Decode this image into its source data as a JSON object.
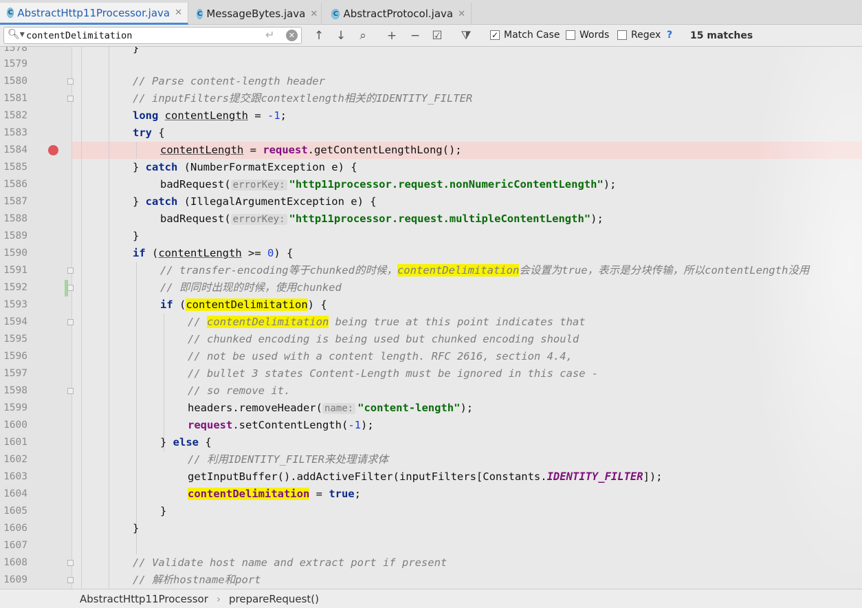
{
  "tabs": [
    {
      "label": "AbstractHttp11Processor.java",
      "active": true
    },
    {
      "label": "MessageBytes.java",
      "active": false
    },
    {
      "label": "AbstractProtocol.java",
      "active": false
    }
  ],
  "find": {
    "query": "contentDelimitation",
    "options": {
      "match_case": "Match Case",
      "words": "Words",
      "regex": "Regex",
      "help": "?"
    },
    "match_case_checked": true,
    "matches": "15 matches"
  },
  "gutter": {
    "lines": [
      "1578",
      "1579",
      "1580",
      "1581",
      "1582",
      "1583",
      "1584",
      "1585",
      "1586",
      "1587",
      "1588",
      "1589",
      "1590",
      "1591",
      "1592",
      "1593",
      "1594",
      "1595",
      "1596",
      "1597",
      "1598",
      "1599",
      "1600",
      "1601",
      "1602",
      "1603",
      "1604",
      "1605",
      "1606",
      "1607",
      "1608",
      "1609"
    ],
    "breakpoint_line": "1584"
  },
  "code": {
    "l1578": "}",
    "l1580": "// Parse content-length header",
    "l1581": "// inputFilters提交跟contextlength相关的IDENTITY_FILTER",
    "l1582a": "long",
    "l1582b": "contentLength",
    "l1582c": " = ",
    "l1582d": "-1",
    "l1582e": ";",
    "l1583a": "try",
    "l1583b": " {",
    "l1584a": "contentLength",
    "l1584b": " = ",
    "l1584c": "request",
    "l1584d": ".getContentLengthLong();",
    "l1585a": "} ",
    "l1585b": "catch",
    "l1585c": " (NumberFormatException e) {",
    "l1586a": "badRequest(",
    "l1586b": "errorKey:",
    "l1586c": "\"http11processor.request.nonNumericContentLength\"",
    "l1586d": ");",
    "l1587a": "} ",
    "l1587b": "catch",
    "l1587c": " (IllegalArgumentException e) {",
    "l1588a": "badRequest(",
    "l1588b": "errorKey:",
    "l1588c": "\"http11processor.request.multipleContentLength\"",
    "l1588d": ");",
    "l1589": "}",
    "l1590a": "if",
    "l1590b": " (",
    "l1590c": "contentLength",
    "l1590d": " >= ",
    "l1590e": "0",
    "l1590f": ") {",
    "l1591a": "// transfer-encoding等于chunked的时候，",
    "l1591b": "contentDelimitation",
    "l1591c": "会设置为true，表示是分块传输，所以contentLength没用",
    "l1592": "// 即同时出现的时候，使用chunked",
    "l1593a": "if",
    "l1593b": " (",
    "l1593c": "contentDelimitation",
    "l1593d": ") {",
    "l1594a": "// ",
    "l1594b": "contentDelimitation",
    "l1594c": " being true at this point indicates that",
    "l1595": "// chunked encoding is being used but chunked encoding should",
    "l1596": "// not be used with a content length. RFC 2616, section 4.4,",
    "l1597": "// bullet 3 states Content-Length must be ignored in this case -",
    "l1598": "// so remove it.",
    "l1599a": "headers.removeHeader(",
    "l1599b": "name:",
    "l1599c": "\"content-length\"",
    "l1599d": ");",
    "l1600a": "request",
    "l1600b": ".setContentLength(",
    "l1600c": "-1",
    "l1600d": ");",
    "l1601a": "} ",
    "l1601b": "else",
    "l1601c": " {",
    "l1602": "// 利用IDENTITY_FILTER来处理请求体",
    "l1603a": "getInputBuffer().addActiveFilter(inputFilters[Constants.",
    "l1603b": "IDENTITY_FILTER",
    "l1603c": "]);",
    "l1604a": "contentDelimitation",
    "l1604b": " = ",
    "l1604c": "true",
    "l1604d": ";",
    "l1605": "}",
    "l1606": "}",
    "l1608": "// Validate host name and extract port if present",
    "l1609": "// 解析hostname和port"
  },
  "breadcrumb": [
    "AbstractHttp11Processor",
    "prepareRequest()"
  ]
}
